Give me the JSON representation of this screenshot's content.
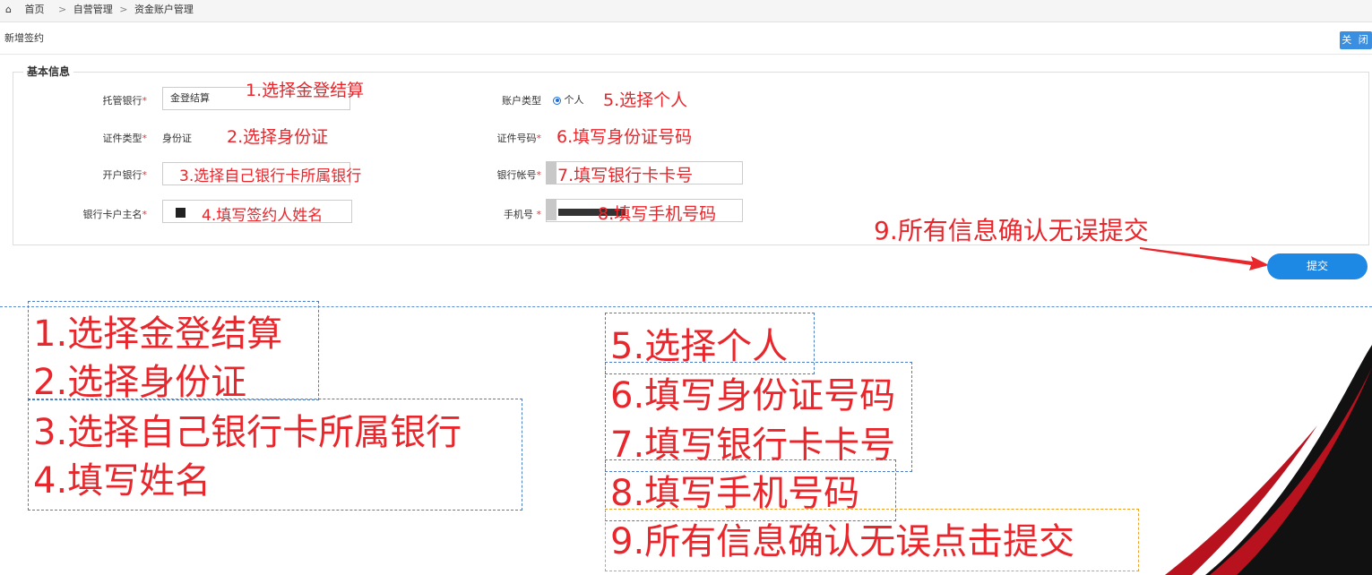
{
  "breadcrumb": {
    "home": "首页",
    "sep1": ">",
    "item1": "自营管理",
    "sep2": ">",
    "item2": "资金账户管理"
  },
  "page": {
    "title": "新增签约",
    "close_label": "关 闭"
  },
  "section": {
    "legend": "基本信息"
  },
  "form": {
    "custodian_bank": {
      "label": "托管银行",
      "value": "金登结算"
    },
    "id_type": {
      "label": "证件类型",
      "value": "身份证"
    },
    "open_bank": {
      "label": "开户银行"
    },
    "account_holder": {
      "label": "银行卡户主名"
    },
    "account_type": {
      "label": "账户类型",
      "option": "个人"
    },
    "id_number": {
      "label": "证件号码"
    },
    "bank_account": {
      "label": "银行帐号"
    },
    "phone": {
      "label": "手机号"
    },
    "required_mark": "*",
    "submit_label": "提交"
  },
  "annotations": {
    "a1": "1.选择金登结算",
    "a2": "2.选择身份证",
    "a3": "3.选择自己银行卡所属银行",
    "a4": "4.填写签约人姓名",
    "a5": "5.选择个人",
    "a6": "6.填写身份证号码",
    "a7": "7.填写银行卡卡号",
    "a8": "8.填写手机号码",
    "a9": "9.所有信息确认无误提交"
  },
  "notes": {
    "left": [
      "1.选择金登结算",
      "2.选择身份证",
      "3.选择自己银行卡所属银行",
      "4.填写姓名"
    ],
    "right": [
      "5.选择个人",
      "6.填写身份证号码",
      "7.填写银行卡卡号",
      "8.填写手机号码",
      "9.所有信息确认无误点击提交"
    ]
  },
  "colors": {
    "annotation_red": "#e8262b",
    "primary_blue": "#1e88e5",
    "decor_red": "#b8121f"
  }
}
